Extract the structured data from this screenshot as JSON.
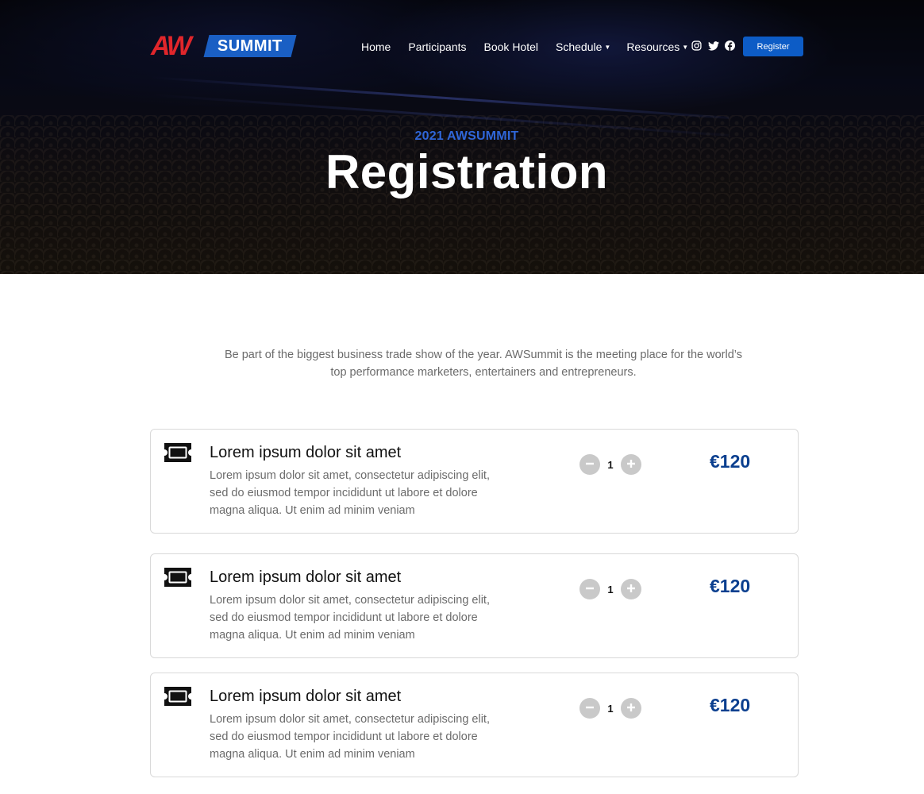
{
  "brand": {
    "logo_aw": "AW",
    "logo_summit": "SUMMIT"
  },
  "nav": {
    "items": [
      {
        "label": "Home"
      },
      {
        "label": "Participants"
      },
      {
        "label": "Book Hotel"
      },
      {
        "label": "Schedule",
        "dropdown": true
      },
      {
        "label": "Resources",
        "dropdown": true
      }
    ],
    "social": [
      "instagram-icon",
      "twitter-icon",
      "facebook-icon"
    ],
    "register_label": "Register"
  },
  "hero": {
    "subtitle": "2021 AWSUMMIT",
    "title": "Registration"
  },
  "intro": {
    "line1": "Be part of the biggest business trade show of the year. AWSummit is the meeting place for the world’s",
    "line2": "top performance marketers, entertainers and entrepreneurs."
  },
  "tickets": [
    {
      "title": "Lorem ipsum dolor sit amet",
      "desc1": "Lorem ipsum dolor sit amet, consectetur adipiscing elit,",
      "desc2": "sed do eiusmod tempor incididunt ut labore et dolore",
      "desc3": "magna aliqua. Ut enim ad minim veniam",
      "quantity": "1",
      "price": "€120"
    },
    {
      "title": "Lorem ipsum dolor sit amet",
      "desc1": "Lorem ipsum dolor sit amet, consectetur adipiscing elit,",
      "desc2": "sed do eiusmod tempor incididunt ut labore et dolore",
      "desc3": "magna aliqua. Ut enim ad minim veniam",
      "quantity": "1",
      "price": "€120"
    },
    {
      "title": "Lorem ipsum dolor sit amet",
      "desc1": "Lorem ipsum dolor sit amet, consectetur adipiscing elit,",
      "desc2": "sed do eiusmod tempor incididunt ut labore et dolore",
      "desc3": "magna aliqua. Ut enim ad minim veniam",
      "quantity": "1",
      "price": "€120"
    }
  ],
  "colors": {
    "accent": "#0d5cc6",
    "price": "#0b3f8f",
    "logo_red": "#e0262b",
    "subtitle": "#2f66d8"
  }
}
